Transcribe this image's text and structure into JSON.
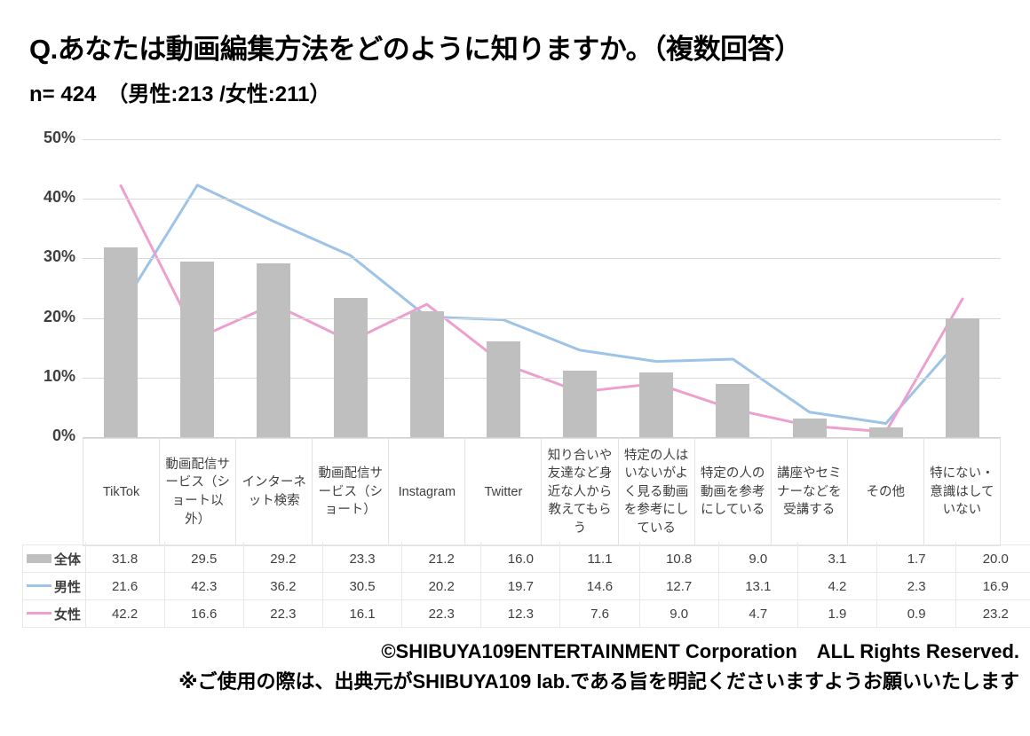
{
  "title": "Q.あなたは動画編集方法をどのように知りますか。（複数回答）",
  "subtitle": "n= 424　（男性:213 /女性:211）",
  "footer": {
    "line1": "©SHIBUYA109ENTERTAINMENT Corporation　ALL Rights Reserved.",
    "line2": "※ご使用の際は、出典元がSHIBUYA109 lab.である旨を明記くださいますようお願いいたします"
  },
  "colors": {
    "bar": "#bfbfbf",
    "male_line": "#9dc3e6",
    "female_line": "#ed9fd0",
    "gridline": "#d9d9d9",
    "text": "#3f3f3f"
  },
  "chart_data": {
    "type": "bar",
    "title": "Q.あなたは動画編集方法をどのように知りますか。（複数回答）",
    "subtitle": "n= 424　（男性:213 /女性:211）",
    "xlabel": "",
    "ylabel": "",
    "ylim": [
      0,
      50
    ],
    "ytick_labels": [
      "0%",
      "10%",
      "20%",
      "30%",
      "40%",
      "50%"
    ],
    "ytick_values": [
      0,
      10,
      20,
      30,
      40,
      50
    ],
    "grid": true,
    "legend_position": "table-row-labels",
    "categories": [
      "TikTok",
      "動画配信サービス（ショート以外）",
      "インターネット検索",
      "動画配信サービス（ショート）",
      "Instagram",
      "Twitter",
      "知り合いや友達など身近な人から教えてもらう",
      "特定の人はいないがよく見る動画を参考にしている",
      "特定の人の動画を参考にしている",
      "講座やセミナーなどを受講する",
      "その他",
      "特にない・意識はしていない"
    ],
    "series": [
      {
        "name": "全体",
        "type": "bar",
        "color": "#bfbfbf",
        "values": [
          31.8,
          29.5,
          29.2,
          23.3,
          21.2,
          16.0,
          11.1,
          10.8,
          9.0,
          3.1,
          1.7,
          20.0
        ]
      },
      {
        "name": "男性",
        "type": "line",
        "color": "#9dc3e6",
        "values": [
          21.6,
          42.3,
          36.2,
          30.5,
          20.2,
          19.7,
          14.6,
          12.7,
          13.1,
          4.2,
          2.3,
          16.9
        ]
      },
      {
        "name": "女性",
        "type": "line",
        "color": "#ed9fd0",
        "values": [
          42.2,
          16.6,
          22.3,
          16.1,
          22.3,
          12.3,
          7.6,
          9.0,
          4.7,
          1.9,
          0.9,
          23.2
        ]
      }
    ]
  }
}
